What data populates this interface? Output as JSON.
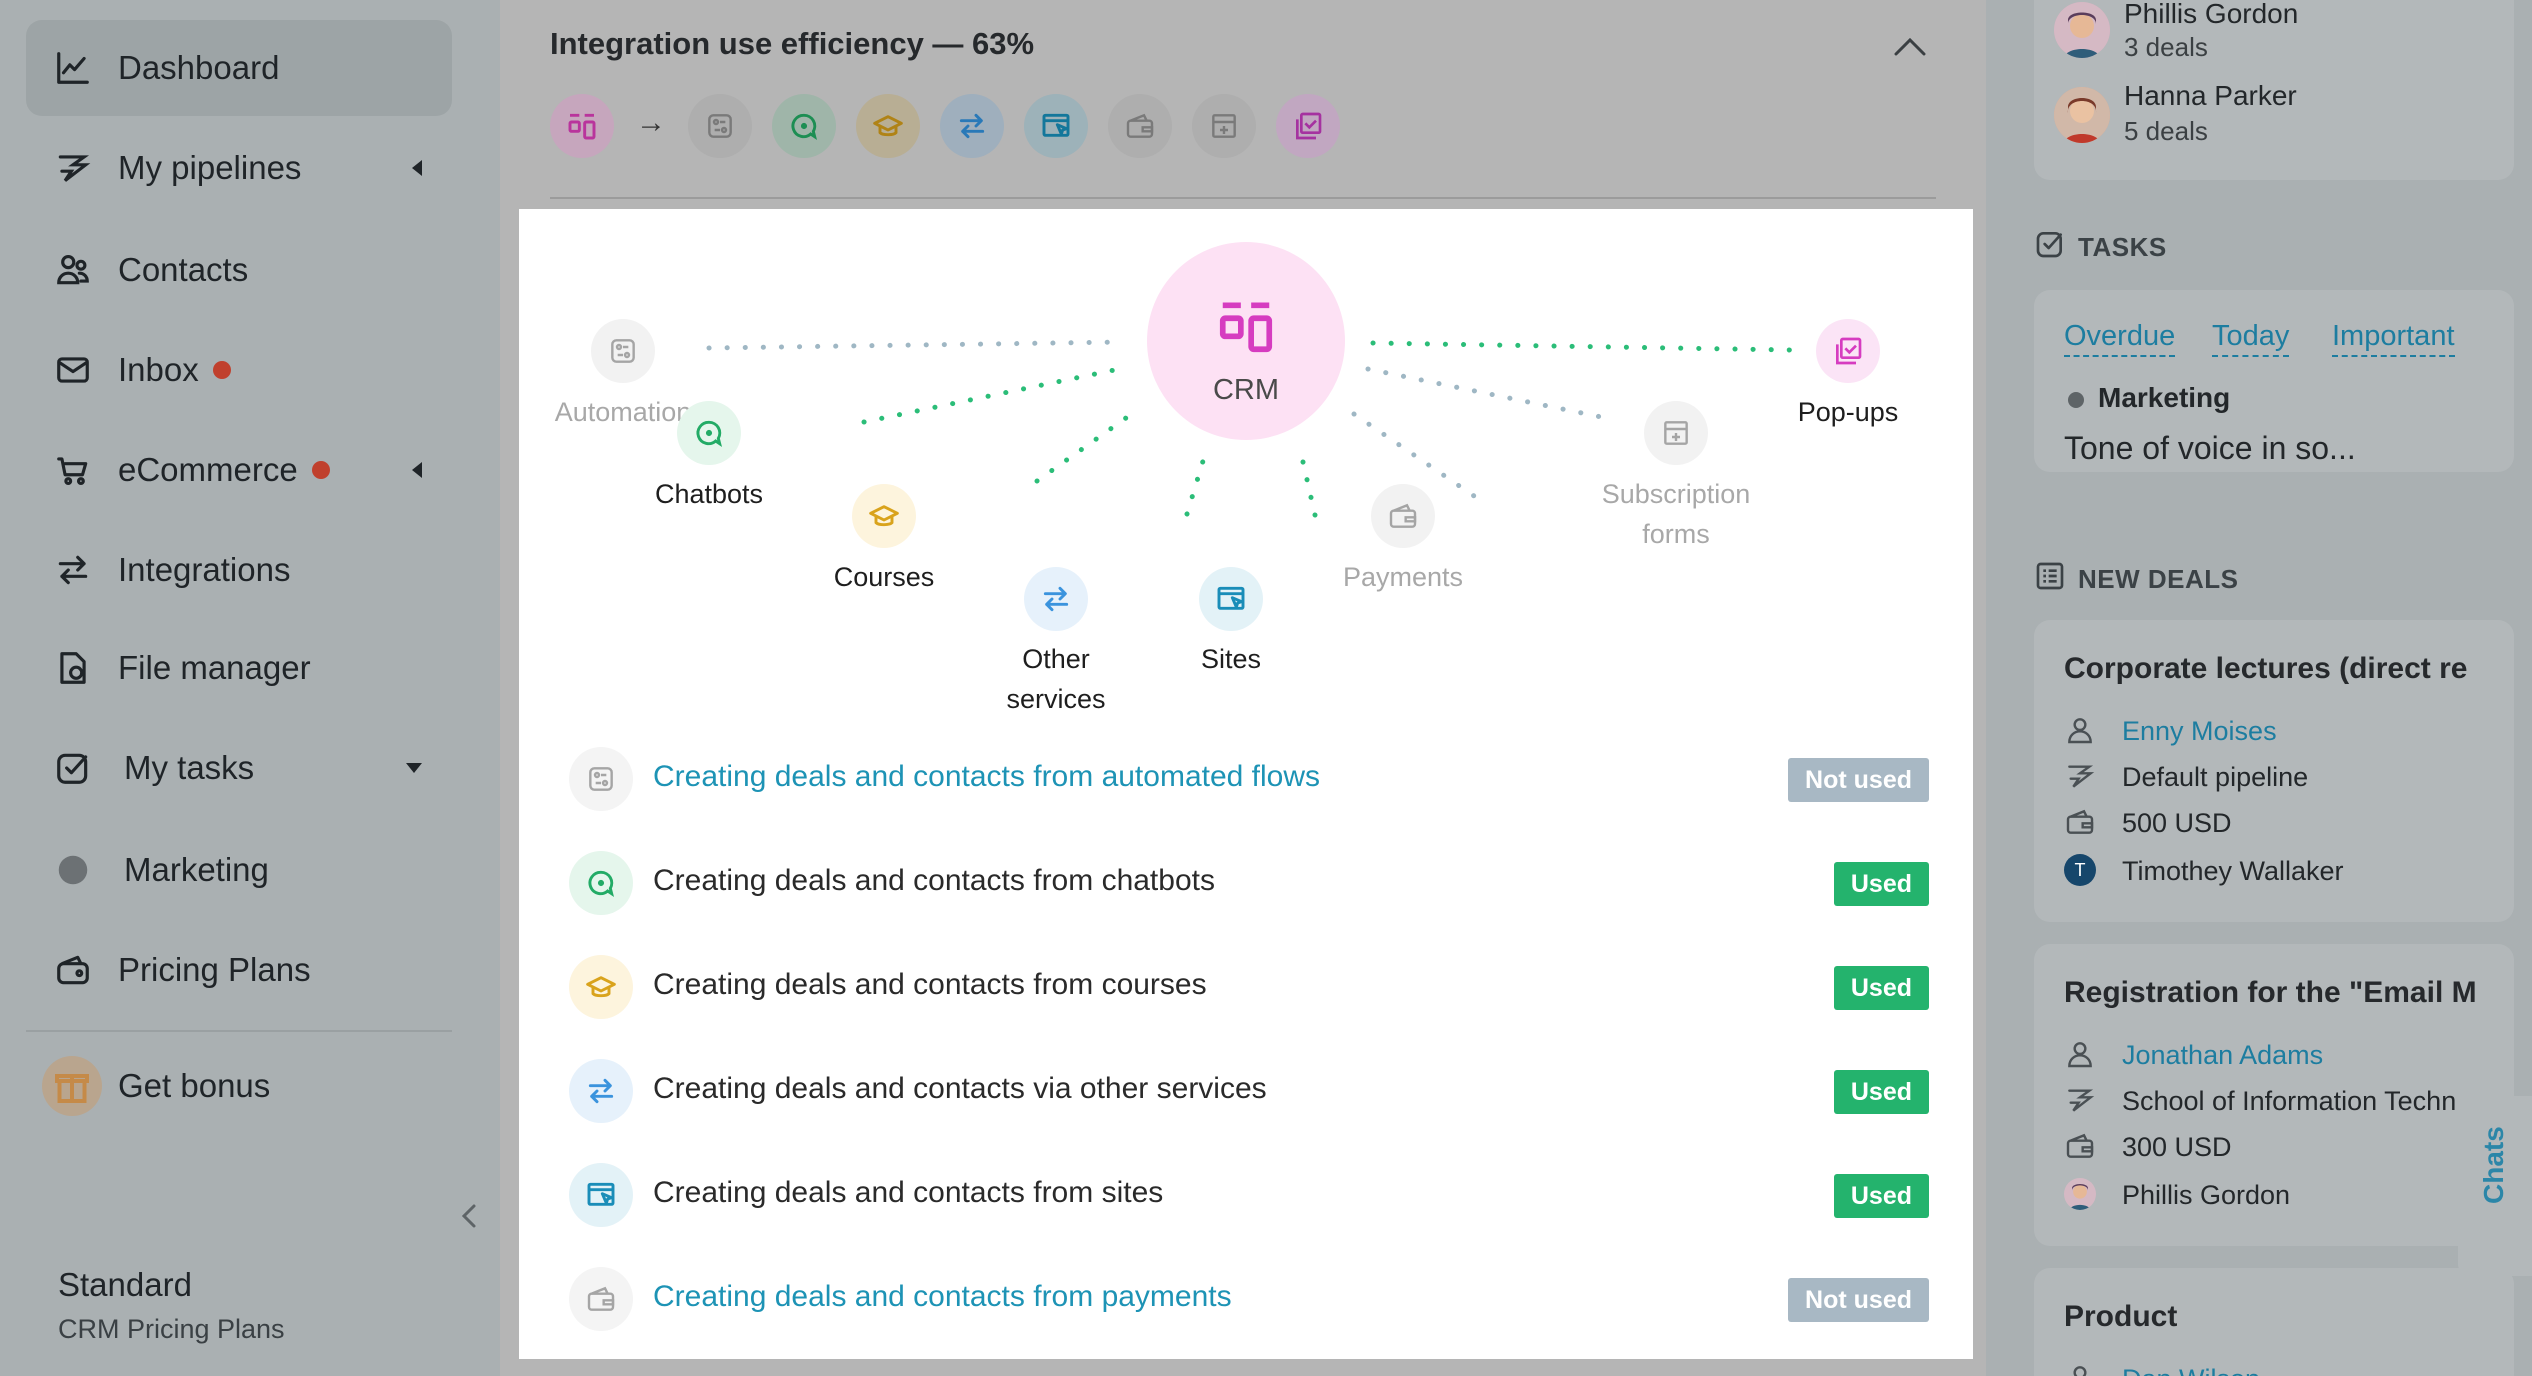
{
  "sidebar": {
    "items": [
      {
        "label": "Dashboard",
        "icon": "chart-line-icon"
      },
      {
        "label": "My pipelines",
        "icon": "pipeline-icon"
      },
      {
        "label": "Contacts",
        "icon": "contacts-icon"
      },
      {
        "label": "Inbox",
        "icon": "envelope-icon"
      },
      {
        "label": "eCommerce",
        "icon": "cart-icon"
      },
      {
        "label": "Integrations",
        "icon": "arrows-exchange-icon"
      },
      {
        "label": "File manager",
        "icon": "file-icon"
      },
      {
        "label": "My tasks",
        "icon": "checkbox-icon"
      },
      {
        "label": "Marketing",
        "icon": "gray-dot-icon"
      },
      {
        "label": "Pricing Plans",
        "icon": "wallet-icon"
      },
      {
        "label": "Get bonus",
        "icon": "gift-icon"
      }
    ],
    "plan": {
      "name": "Standard",
      "sub": "CRM Pricing Plans"
    }
  },
  "main": {
    "title": "Integration use efficiency — 63%",
    "chain_arrow": "→",
    "diagram": {
      "center": "CRM",
      "nodes": [
        {
          "label": "Automation",
          "active": false
        },
        {
          "label": "Chatbots",
          "active": true
        },
        {
          "label": "Courses",
          "active": true
        },
        {
          "label": "Other services",
          "active": true
        },
        {
          "label": "Sites",
          "active": true
        },
        {
          "label": "Payments",
          "active": false
        },
        {
          "label": "Subscription forms",
          "active": false
        },
        {
          "label": "Pop-ups",
          "active": true
        }
      ]
    },
    "rows": [
      {
        "text": "Creating deals and contacts from automated flows",
        "status": "Not used",
        "icon": "automation-icon"
      },
      {
        "text": "Creating deals and contacts from chatbots",
        "status": "Used",
        "icon": "chatbot-icon"
      },
      {
        "text": "Creating deals and contacts from courses",
        "status": "Used",
        "icon": "graduation-cap-icon"
      },
      {
        "text": "Creating deals and contacts via other services",
        "status": "Used",
        "icon": "arrows-exchange-icon"
      },
      {
        "text": "Creating deals and contacts from sites",
        "status": "Used",
        "icon": "site-cursor-icon"
      },
      {
        "text": "Creating deals and contacts from payments",
        "status": "Not used",
        "icon": "wallet-icon"
      }
    ]
  },
  "right": {
    "people": [
      {
        "name": "Phillis Gordon",
        "deals": "3 deals"
      },
      {
        "name": "Hanna Parker",
        "deals": "5 deals"
      }
    ],
    "tasks": {
      "title": "TASKS",
      "tabs": [
        "Overdue",
        "Today",
        "Important"
      ],
      "task_tag": "Marketing",
      "task_text": "Tone of voice in so..."
    },
    "new_deals": {
      "title": "NEW DEALS",
      "deals": [
        {
          "title": "Corporate lectures (direct re",
          "contact": "Enny Moises",
          "pipeline": "Default pipeline",
          "amount": "500 USD",
          "owner": "Timothey Wallaker",
          "owner_initial": "T"
        },
        {
          "title": "Registration for the \"Email M",
          "contact": "Jonathan Adams",
          "pipeline": "School of Information Techn",
          "amount": "300 USD",
          "owner": "Phillis Gordon"
        },
        {
          "title": "Product",
          "contact": "Dan Wilson"
        }
      ]
    },
    "chats_label": "Chats"
  },
  "colors": {
    "used": "#24b36d",
    "not_used": "#a8b8c4",
    "link": "#1d93b5",
    "crm_pink": "#fde1f4",
    "crm_icon": "#d63cc0"
  }
}
